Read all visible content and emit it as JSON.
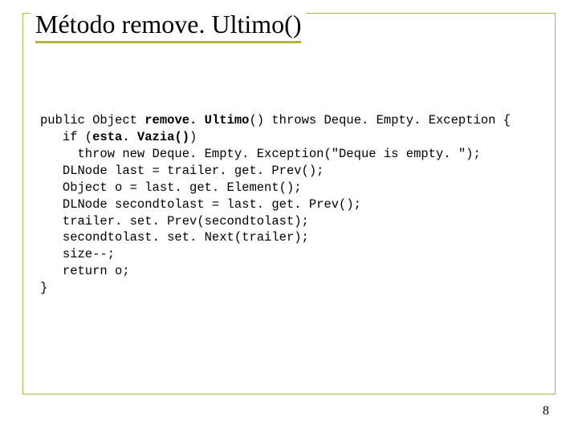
{
  "title": "Método remove. Ultimo()",
  "page_number": "8",
  "code": {
    "l1a": "public Object ",
    "l1b": "remove. Ultimo",
    "l1c": "() throws Deque. Empty. Exception {",
    "l2a": "   if (",
    "l2b": "esta. Vazia()",
    "l2c": ")",
    "l3": "     throw new Deque. Empty. Exception(\"Deque is empty. \");",
    "l4": "   DLNode last = trailer. get. Prev();",
    "l5": "   Object o = last. get. Element();",
    "l6": "   DLNode secondtolast = last. get. Prev();",
    "l7": "   trailer. set. Prev(secondtolast);",
    "l8": "   secondtolast. set. Next(trailer);",
    "l9": "   size--;",
    "l10": "   return o;",
    "l11": "}"
  }
}
